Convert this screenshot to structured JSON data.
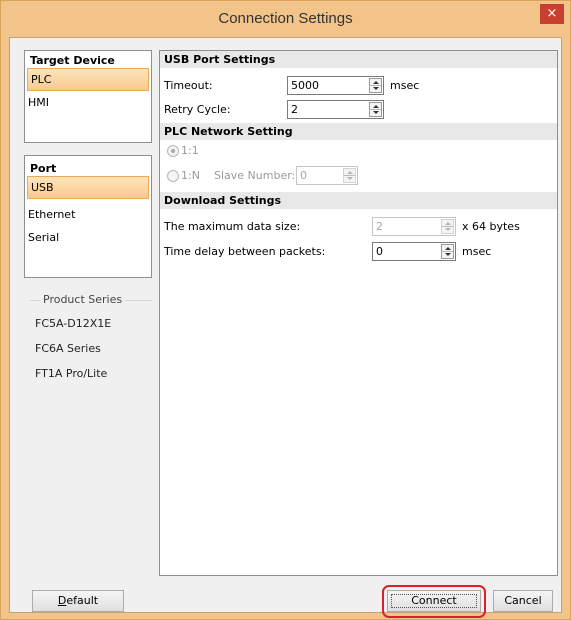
{
  "window": {
    "title": "Connection Settings",
    "close_label": "×"
  },
  "target_device": {
    "heading": "Target Device",
    "items": [
      {
        "label": "PLC",
        "selected": true
      },
      {
        "label": "HMI",
        "selected": false
      }
    ]
  },
  "port": {
    "heading": "Port",
    "items": [
      {
        "label": "USB",
        "selected": true
      },
      {
        "label": "Ethernet",
        "selected": false
      },
      {
        "label": "Serial",
        "selected": false
      }
    ]
  },
  "product_series": {
    "legend": "Product Series",
    "items": [
      "FC5A-D12X1E",
      "FC6A Series",
      "FT1A Pro/Lite"
    ]
  },
  "usb_port_settings": {
    "heading": "USB Port Settings",
    "timeout_label": "Timeout:",
    "timeout_value": "5000",
    "timeout_unit": "msec",
    "retry_label": "Retry Cycle:",
    "retry_value": "2"
  },
  "plc_network_setting": {
    "heading": "PLC Network Setting",
    "option_1_1": "1:1",
    "option_1_n": "1:N",
    "slave_number_label": "Slave Number:",
    "slave_number_value": "0"
  },
  "download_settings": {
    "heading": "Download Settings",
    "max_data_label": "The maximum data size:",
    "max_data_value": "2",
    "max_data_unit": "x 64 bytes",
    "delay_label": "Time delay between packets:",
    "delay_value": "0",
    "delay_unit": "msec"
  },
  "buttons": {
    "default_prefix": "D",
    "default_rest": "efault",
    "connect_label": "Connect",
    "cancel_label": "Cancel"
  },
  "colors": {
    "title_bar": "#f3c48a",
    "close_button": "#c8402f",
    "selection": "#f9c98c",
    "highlight_outline": "#d8222a"
  }
}
